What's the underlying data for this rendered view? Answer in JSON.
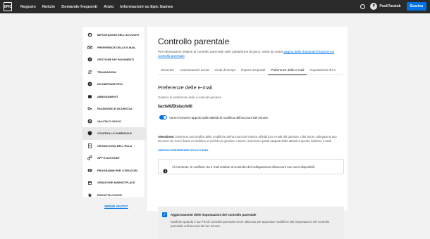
{
  "topbar": {
    "logo": "EPIC",
    "nav": [
      "Negozio",
      "Notizie",
      "Domande frequenti",
      "Aiuto",
      "Informazioni su Epic Games"
    ],
    "avatar_initial": "P",
    "username": "PaskTaratak",
    "download_label": "Scarica"
  },
  "sidebar": {
    "items": [
      {
        "label": "Impostazioni dell'account",
        "icon": "gear-icon",
        "active": false
      },
      {
        "label": "Preferenze delle e-mail",
        "icon": "mail-icon",
        "active": false
      },
      {
        "label": "Gestione dei pagamenti",
        "icon": "dollar-icon",
        "active": false
      },
      {
        "label": "Transazioni",
        "icon": "transactions-icon",
        "active": false
      },
      {
        "label": "Ricompense Epic",
        "icon": "reward-icon",
        "active": false
      },
      {
        "label": "Abbonamenti",
        "icon": "subscription-icon",
        "active": false
      },
      {
        "label": "Password e sicurezza",
        "icon": "key-icon",
        "active": false
      },
      {
        "label": "Valuta di gioco",
        "icon": "coin-icon",
        "active": false
      },
      {
        "label": "Controllo parentale",
        "icon": "shield-icon",
        "active": true
      },
      {
        "label": "Cronologia dell'EULA",
        "icon": "document-icon",
        "active": false
      },
      {
        "label": "App e account",
        "icon": "link-icon",
        "active": false
      },
      {
        "label": "Programmi per i creatori",
        "icon": "creator-icon",
        "active": false
      },
      {
        "label": "Venditore Marketplace",
        "icon": "store-icon",
        "active": false
      },
      {
        "label": "Riscatta codice",
        "icon": "star-icon",
        "active": false
      }
    ],
    "help_label": "SERVE AIUTO?"
  },
  "main": {
    "title": "Controllo parentale",
    "intro_text": "Per informazioni relative al controllo parentale sulle piattaforme di gioco, visita la nostra ",
    "intro_link": "pagina delle domande frequenti sul controllo parentale",
    "intro_end": ".",
    "tabs": [
      "Generale",
      "Autorizzazioni social",
      "Limiti di tempo",
      "Report temporali",
      "Preferenze delle e-mail",
      "Impostazioni di Fo"
    ],
    "active_tab": 4,
    "section_title": "Preferenze delle e-mail",
    "section_sub": "Gestisci le preferenze delle e-mail del genitore.",
    "subscribe_heading": "Iscriviti/Disiscriviti",
    "toggle_label": "Vorrei ricevere rapporti sulle attività di modifica dell'account del minore",
    "toggle_on": true,
    "warning_label": "Attenzione:",
    "warning_text": " invieremo una notifica delle modifiche dell'account del minore all'indirizzo e-mail del genitore o del tutore collegato al suo account. Se non ti fosse un indirizzo e-mail di un genitore o tutore, invieremo questi rapporti delle attività a questo indirizzo e-mail.",
    "manage_link": "Gestisci preferenze delle e-mail",
    "info_text": "Al momento, le notifiche via e-mail relative al Controllo del collegamento all'account non sono disponibili.",
    "notification": {
      "title": "Aggiornamenti delle impostazioni del controllo parentale",
      "checked": true,
      "description": "Notifiche quando il tuo PIN di controllo parentale viene utilizzato per apportare modifiche alle impostazioni del controllo parentale sull'account del tuo minore."
    }
  },
  "colors": {
    "accent": "#0074e4",
    "topbar": "#2a2a2a",
    "page_bg": "#f2f2f2"
  }
}
